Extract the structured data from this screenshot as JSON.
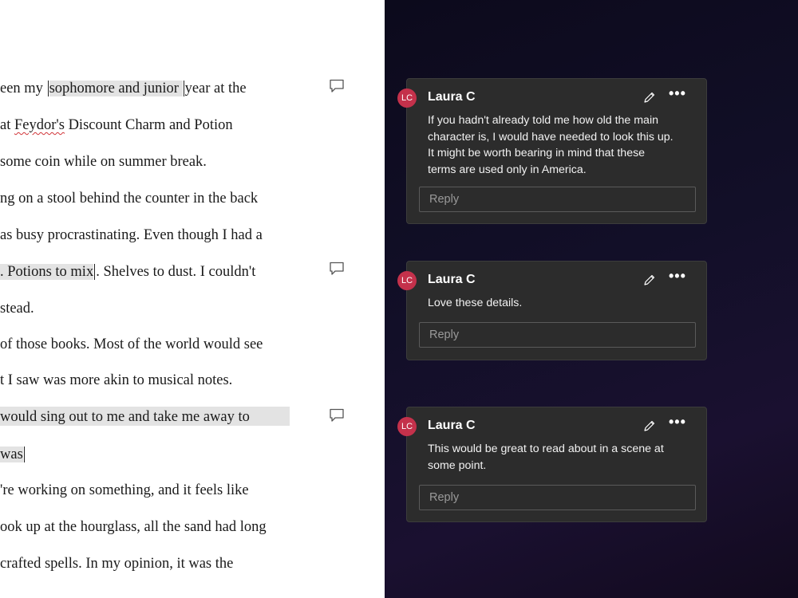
{
  "document": {
    "lines": [
      {
        "before": "een my ",
        "highlight": "sophomore and junior ",
        "after": "year at the"
      },
      {
        "before": " at ",
        "squiggle": "Feydor's",
        "after": " Discount Charm and Potion"
      },
      {
        "text": " some coin while on summer break."
      },
      {
        "text": "ng on a stool behind the counter in the back"
      },
      {
        "text": "as busy procrastinating. Even though I had a"
      },
      {
        "highlight": ". Potions to mix",
        "after": ". Shelves to dust. I couldn't"
      },
      {
        "text": "stead."
      },
      {
        "text": "of those books. Most of the world would see"
      },
      {
        "text": "t I saw was more akin to musical notes."
      },
      {
        "text": "would sing out to me and take me away to"
      },
      {
        "highlight": " was",
        "after": ""
      },
      {
        "text": "'re working on something, and it feels like"
      },
      {
        "text": "ook up at the hourglass, all the sand had long"
      },
      {
        "text": "crafted spells. In my opinion, it was the"
      }
    ]
  },
  "comments": [
    {
      "initials": "LC",
      "author": "Laura C",
      "text": "If you hadn't already told me how old the main character is, I would have needed to look this up. It might be worth bearing in mind that these terms are used only in America.",
      "reply_placeholder": "Reply"
    },
    {
      "initials": "LC",
      "author": "Laura C",
      "text": "Love these details.",
      "reply_placeholder": "Reply"
    },
    {
      "initials": "LC",
      "author": "Laura C",
      "text": "This would be great to read about in a scene at some point.",
      "reply_placeholder": "Reply"
    }
  ],
  "icons": {
    "comment_marker": "comment-icon",
    "edit": "pencil-icon",
    "more": "more-options-icon"
  },
  "colors": {
    "avatar": "#c4314b",
    "card_bg": "#2c2c2c",
    "highlight": "#e3e3e3"
  }
}
